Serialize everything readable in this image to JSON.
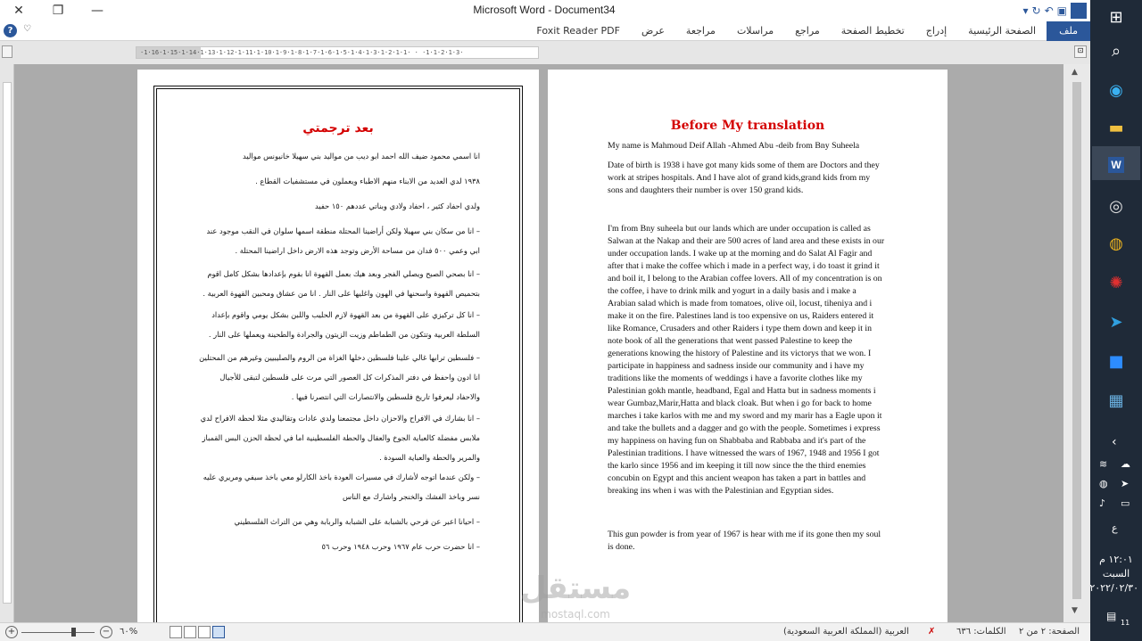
{
  "window": {
    "title": "Microsoft Word  -  Document34",
    "close_glyph": "✕",
    "restore_glyph": "❐",
    "minimize_glyph": "—",
    "app_badge": "W"
  },
  "ribbon": {
    "tabs": [
      "ملف",
      "الصفحة الرئيسية",
      "إدراج",
      "تخطيط الصفحة",
      "مراجع",
      "مراسلات",
      "مراجعة",
      "عرض",
      "Foxit Reader PDF"
    ],
    "help_glyph": "?",
    "collapse_glyph": "♡"
  },
  "ruler": {
    "text": "·1·16·1·15·1·14·1·13·1·12·1·11·1·10·1·9·1·8·1·7·1·6·1·5·1·4·1·3·1·2·1·1· · ·1·1·2·1·3·",
    "right_btn": "⊡"
  },
  "left_page": {
    "title": "بعد ترجمتي",
    "paragraphs": [
      "انا اسمي محمود ضيف الله احمد ابو ديب من مواليد بني سهيلا خانيونس مواليد",
      "١٩٣٨ لدي العديد من الابناء منهم الاطباء ويعملون في مستشفيات القطاع .",
      "ولدي احفاد كثير ، احفاد ولادي وبناتي عددهم ١٥٠ حفيد",
      "– انا من سكان بني سهيلا ولكن أراضينا المحتلة منطقة اسمها سلوان في النقب موجود عند ابي وعمي ٥٠٠ فدان من مساحة الأرض وتوجد هذه الارض داخل اراضينا المحتلة .",
      "– انا بصحي الصبح ويصلي الفجر وبعد هيك بعمل القهوة انا بقوم بإعدادها بشكل كامل اقوم بتحميص القهوة واسحنها في الهون واغليها على النار . انا من عشاق ومحبين القهوة العربية .",
      "– انا كل تركيزي على القهوة من بعد القهوة لازم الحليب واللبن بشكل يومي واقوم بإعداد السلطة العربية وتتكون من الطماطم وزيت الزيتون والجرادة والطحينة ويعملها على النار .",
      "– فلسطين ترابها غالي علينا فلسطين دخلها الغزاة من الروم والصليبيين وغيرهم من المحتلين انا ادون واحفظ في دفتر المذكرات كل العصور التي مرت على فلسطين لتبقى للأجيال والاحفاد ليعرفوا تاريخ فلسطين والانتصارات التي انتصرنا فيها .",
      "– انا بشارك في الافراح والاحزان داخل مجتمعنا ولدي عادات وتقاليدي مثلا لحظة الافراح لدي ملابس مفضلة كالعباية الجوخ والعقال والحطة الفلسطينية اما في لحظة الحزن البس القمباز والمرير والحطة والعباية السودة .",
      "– ولكن عندما اتوجه لأشارك في مسيرات العودة باخذ الكارلو معي باخذ سيفي ومريري عليه نسر وباخذ الفشك والخنجر واشارك مع الناس",
      "– احيانا اعبر عن فرحي بالشبابة على الشبابة والربابة وهي من التراث الفلسطيني",
      "– انا حضرت حرب عام ١٩٦٧ وحرب ١٩٤٨ وحرب ٥٦"
    ]
  },
  "right_page": {
    "title": "Before My translation",
    "paragraphs": [
      "My name is Mahmoud Deif Allah -Ahmed Abu -deib from Bny Suheela",
      "Date of birth is 1938 i have got many kids some of them are Doctors and they work at stripes hospitals. And I have alot of grand kids,grand kids from my sons and daughters their number is over 150 grand kids.",
      "I'm from Bny suheela but our lands which are under occupation is called as Salwan at the Nakap and their are 500 acres of land area and these exists in our under occupation lands. I wake up at the morning and do Salat Al Fagir and after that i make the coffee which i made in a perfect way, i do toast it grind it and boil it, I belong to the Arabian coffee lovers. All of my concentration is on the coffee, i have to drink milk and yogurt in a daily basis and i make a Arabian salad which is made from tomatoes, olive oil, locust, tiheniya and i make it on the fire. Palestines land is too expensive on us, Raiders entered it like Romance, Crusaders and other Raiders i type them down and keep it in note book of all the generations that went passed Palestine to keep the generations knowing the history of Palestine and its victorys that we won. I participate in happiness and sadness inside our community and i have my traditions like the moments of weddings i have a favorite clothes like my Palestinian gokh mantle, headband, Egal and Hatta  but in sadness moments i wear Gumbaz,Marir,Hatta and black cloak. But when i  go for back to home marches i take karlos with me and my sword and my marir has a Eagle upon it and take the bullets and a dagger  and go with the people. Sometimes i express my happiness on having fun on Shabbaba and Rabbaba and it's part of the Palestinian traditions. I have witnessed the wars of 1967, 1948 and 1956 I got the karlo since 1956 and im keeping it till now since the the third enemies concubin on Egypt and this ancient weapon has taken a part in battles and breaking ins when i was with the Palestinian and Egyptian sides.",
      "This gun powder is from year of 1967 is hear with me if its gone then my soul is done."
    ]
  },
  "watermark": {
    "main": "مستقل",
    "sub": "mostaql.com"
  },
  "statusbar": {
    "page": "الصفحة: ٢ من ٢",
    "words": "الكلمات: ٦٣٦",
    "language": "العربية (المملكة العربية السعودية)",
    "zoom": "٦٠%",
    "zoom_minus": "−",
    "zoom_plus": "+"
  },
  "taskbar": {
    "clock_time": "١٢:٠١ م",
    "clock_day": "السبت",
    "clock_date": "٢٠٢٢/٠٢/٣٠",
    "lang": "ع",
    "notif": "11"
  }
}
